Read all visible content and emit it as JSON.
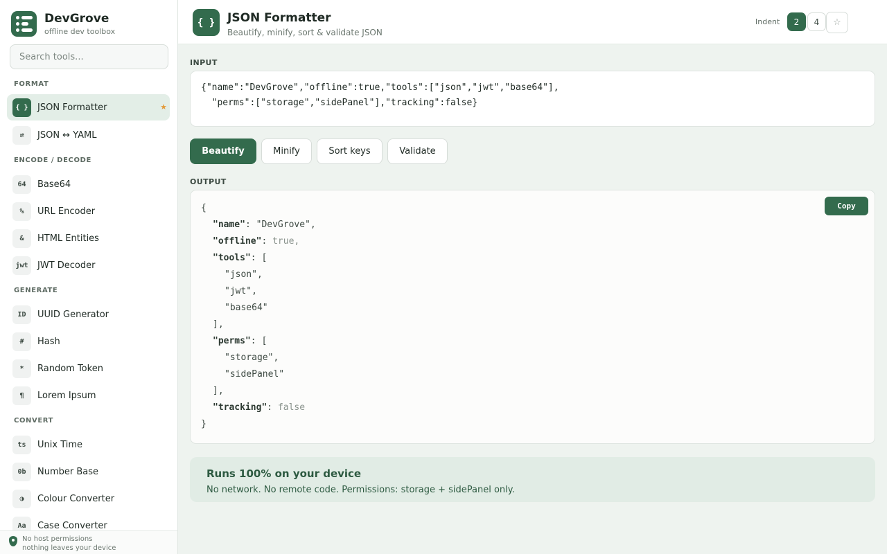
{
  "brand": {
    "title": "DevGrove",
    "subtitle": "offline dev toolbox"
  },
  "search": {
    "placeholder": "Search tools..."
  },
  "sidebar": {
    "groups": [
      {
        "label": "FORMAT"
      },
      {
        "label": "ENCODE / DECODE"
      },
      {
        "label": "GENERATE"
      },
      {
        "label": "CONVERT"
      }
    ],
    "items": [
      {
        "icon": "{ }",
        "label": "JSON Formatter",
        "active": true,
        "starred": true
      },
      {
        "icon": "⇄",
        "label": "JSON ↔ YAML"
      },
      {
        "icon": "64",
        "label": "Base64"
      },
      {
        "icon": "%",
        "label": "URL Encoder"
      },
      {
        "icon": "&",
        "label": "HTML Entities"
      },
      {
        "icon": "jwt",
        "label": "JWT Decoder"
      },
      {
        "icon": "ID",
        "label": "UUID Generator"
      },
      {
        "icon": "#",
        "label": "Hash"
      },
      {
        "icon": "*",
        "label": "Random Token"
      },
      {
        "icon": "¶",
        "label": "Lorem Ipsum"
      },
      {
        "icon": "ts",
        "label": "Unix Time"
      },
      {
        "icon": "0b",
        "label": "Number Base"
      },
      {
        "icon": "◑",
        "label": "Colour Converter"
      },
      {
        "icon": "Aa",
        "label": "Case Converter"
      }
    ],
    "star_glyph": "★",
    "footer": {
      "line1": "No host permissions",
      "line2": "nothing leaves your device"
    }
  },
  "header": {
    "icon": "{ }",
    "title": "JSON Formatter",
    "subtitle": "Beautify, minify, sort & validate JSON",
    "indent_label": "Indent",
    "indent_options": [
      "2",
      "4"
    ],
    "indent_selected": "2",
    "favorite_glyph": "☆"
  },
  "input": {
    "label": "INPUT",
    "value": "{\"name\":\"DevGrove\",\"offline\":true,\"tools\":[\"json\",\"jwt\",\"base64\"],\n  \"perms\":[\"storage\",\"sidePanel\"],\"tracking\":false}"
  },
  "actions": {
    "beautify": "Beautify",
    "minify": "Minify",
    "sort": "Sort keys",
    "validate": "Validate"
  },
  "output": {
    "label": "OUTPUT",
    "copy_label": "Copy",
    "lines": [
      {
        "indent": 0,
        "tokens": [
          [
            "p",
            "{"
          ]
        ]
      },
      {
        "indent": 1,
        "tokens": [
          [
            "k",
            "\"name\""
          ],
          [
            "p",
            ": "
          ],
          [
            "s",
            "\"DevGrove\""
          ],
          [
            "p",
            ","
          ]
        ]
      },
      {
        "indent": 1,
        "tokens": [
          [
            "k",
            "\"offline\""
          ],
          [
            "p",
            ": "
          ],
          [
            "lit",
            "true,"
          ]
        ]
      },
      {
        "indent": 1,
        "tokens": [
          [
            "k",
            "\"tools\""
          ],
          [
            "p",
            ": ["
          ]
        ]
      },
      {
        "indent": 2,
        "tokens": [
          [
            "s",
            "\"json\""
          ],
          [
            "p",
            ","
          ]
        ]
      },
      {
        "indent": 2,
        "tokens": [
          [
            "s",
            "\"jwt\""
          ],
          [
            "p",
            ","
          ]
        ]
      },
      {
        "indent": 2,
        "tokens": [
          [
            "s",
            "\"base64\""
          ]
        ]
      },
      {
        "indent": 1,
        "tokens": [
          [
            "p",
            "],"
          ]
        ]
      },
      {
        "indent": 1,
        "tokens": [
          [
            "k",
            "\"perms\""
          ],
          [
            "p",
            ": ["
          ]
        ]
      },
      {
        "indent": 2,
        "tokens": [
          [
            "s",
            "\"storage\""
          ],
          [
            "p",
            ","
          ]
        ]
      },
      {
        "indent": 2,
        "tokens": [
          [
            "s",
            "\"sidePanel\""
          ]
        ]
      },
      {
        "indent": 1,
        "tokens": [
          [
            "p",
            "],"
          ]
        ]
      },
      {
        "indent": 1,
        "tokens": [
          [
            "k",
            "\"tracking\""
          ],
          [
            "p",
            ": "
          ],
          [
            "lit",
            "false"
          ]
        ]
      },
      {
        "indent": 0,
        "tokens": [
          [
            "p",
            "}"
          ]
        ]
      }
    ]
  },
  "notice": {
    "title": "Runs 100% on your device",
    "text": "No network. No remote code. Permissions: storage + sidePanel only."
  },
  "colors": {
    "accent": "#336b4d",
    "active_bg": "#e3eee7",
    "star": "#e39b3b",
    "notice_bg": "#e1ece5"
  }
}
